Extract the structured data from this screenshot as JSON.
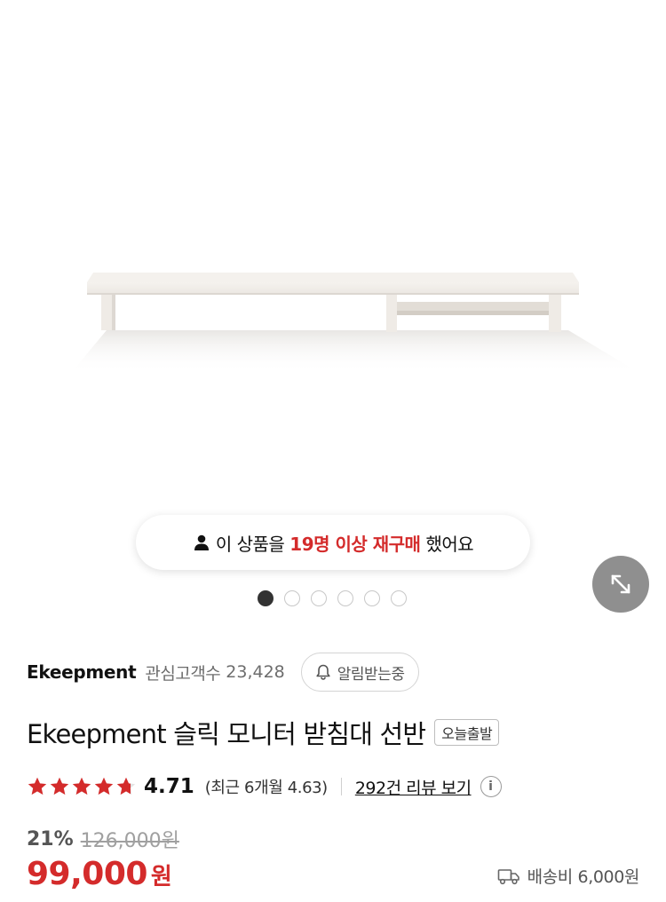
{
  "banner": {
    "prefix": "이 상품을",
    "highlight": "19명 이상 재구매",
    "suffix": "했어요"
  },
  "carousel": {
    "total": 6,
    "active_index": 0
  },
  "brand": {
    "name": "Ekeepment",
    "watch_label": "관심고객수",
    "watch_count": "23,428",
    "alarm_label": "알림받는중"
  },
  "product": {
    "title": "Ekeepment 슬릭 모니터 받침대 선반",
    "tag": "오늘출발"
  },
  "rating": {
    "stars_value": 4.71,
    "score": "4.71",
    "recent": "(최근 6개월 4.63)",
    "review_link": "292건 리뷰 보기"
  },
  "price": {
    "discount": "21%",
    "original": "126,000원",
    "sale": "99,000",
    "currency": "원"
  },
  "shipping": {
    "label": "배송비 6,000원"
  },
  "colors": {
    "accent": "#d42b2b",
    "star": "#d42b2b"
  },
  "icons": {
    "banner": "person-icon",
    "expand": "expand-arrows-icon",
    "alarm": "bell-icon",
    "info": "info-icon",
    "shipping": "truck-icon"
  }
}
